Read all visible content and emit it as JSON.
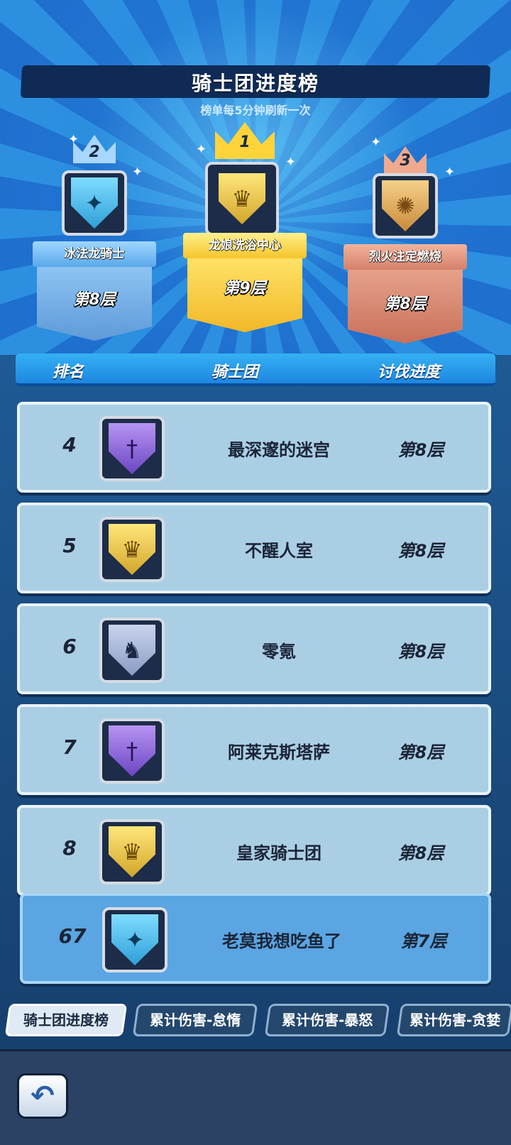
{
  "header": {
    "title": "骑士团进度榜",
    "subtitle": "榜单每5分钟刷新一次"
  },
  "podium": [
    {
      "rank": "2",
      "name": "冰法龙骑士",
      "floor": "第8层",
      "emblem": "ice-star-shield-icon",
      "emblem_glyph": "✦",
      "color": "#6fb7ff"
    },
    {
      "rank": "1",
      "name": "龙娘洗浴中心",
      "floor": "第9层",
      "emblem": "gold-crown-shield-icon",
      "emblem_glyph": "♛",
      "color": "#ffd24a"
    },
    {
      "rank": "3",
      "name": "烈火注定燃烧",
      "floor": "第8层",
      "emblem": "sun-shield-icon",
      "emblem_glyph": "✺",
      "color": "#e08a6c"
    }
  ],
  "table": {
    "columns": [
      "排名",
      "骑士团",
      "讨伐进度"
    ],
    "rows": [
      {
        "rank": "4",
        "name": "最深邃的迷宫",
        "floor": "第8层",
        "emblem": "purple-sword-shield-icon",
        "emblem_glyph": "†",
        "style": "purple"
      },
      {
        "rank": "5",
        "name": "不醒人室",
        "floor": "第8层",
        "emblem": "gold-crown-shield-icon",
        "emblem_glyph": "♛",
        "style": "gold"
      },
      {
        "rank": "6",
        "name": "零氪",
        "floor": "第8层",
        "emblem": "dragon-shield-icon",
        "emblem_glyph": "♞",
        "style": "dark"
      },
      {
        "rank": "7",
        "name": "阿莱克斯塔萨",
        "floor": "第8层",
        "emblem": "purple-sword-shield-icon",
        "emblem_glyph": "†",
        "style": "purple"
      },
      {
        "rank": "8",
        "name": "皇家骑士团",
        "floor": "第8层",
        "emblem": "gold-crown-shield-icon",
        "emblem_glyph": "♛",
        "style": "gold"
      }
    ],
    "my_row": {
      "rank": "67",
      "name": "老莫我想吃鱼了",
      "floor": "第7层",
      "emblem": "ice-star-shield-icon",
      "emblem_glyph": "✦",
      "style": "ice"
    }
  },
  "tabs": [
    {
      "label": "骑士团进度榜",
      "active": true
    },
    {
      "label": "累计伤害-怠惰",
      "active": false
    },
    {
      "label": "累计伤害-暴怒",
      "active": false
    },
    {
      "label": "累计伤害-贪婪",
      "active": false
    }
  ],
  "back_button": {
    "icon": "back-arrow-icon",
    "glyph": "↶"
  }
}
